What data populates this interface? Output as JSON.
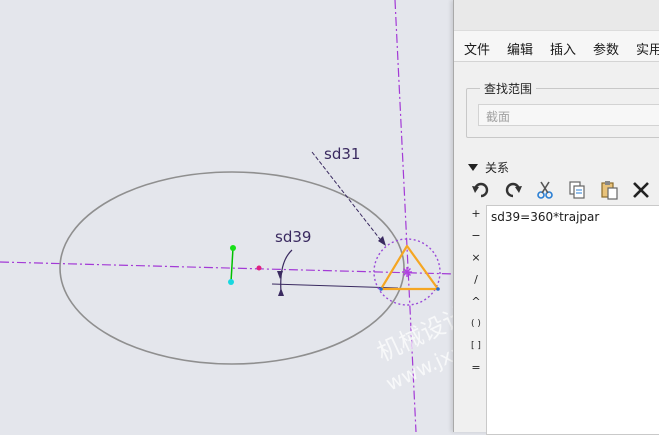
{
  "sketch": {
    "dim_sd31": "sd31",
    "dim_sd39": "sd39"
  },
  "relations_dialog": {
    "menu": [
      "文件",
      "编辑",
      "插入",
      "参数",
      "实用"
    ],
    "scope": {
      "title": "查找范围",
      "value": "截面"
    },
    "relations_section": {
      "label": "关系"
    },
    "toolbar": [
      "undo-icon",
      "redo-icon",
      "cut-icon",
      "copy-icon",
      "paste-icon",
      "delete-icon"
    ],
    "operators": [
      "+",
      "−",
      "×",
      "/",
      "^",
      "( )",
      "[ ]",
      "="
    ],
    "editor_text": "sd39=360*trajpar"
  },
  "watermark": {
    "line1": "机械设计网",
    "line2": "www.jxxd.com"
  },
  "colors": {
    "construction_line": "#a33ad6",
    "ellipse": "#8f8f8f",
    "triangle": "#f5a623",
    "dimension": "#3a2a60"
  }
}
